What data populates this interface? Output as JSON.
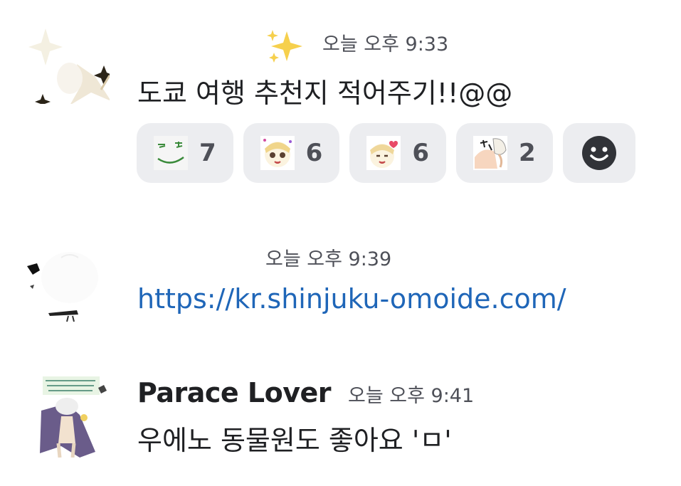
{
  "messages": [
    {
      "username": "",
      "timestamp": "오늘 오후 9:33",
      "content": "도쿄 여행 추천지 적어주기!!@@",
      "reactions": [
        {
          "emoji": "smirk-face-emoji",
          "count": "7"
        },
        {
          "emoji": "crying-girl-emoji",
          "count": "6"
        },
        {
          "emoji": "heart-girl-emoji",
          "count": "6"
        },
        {
          "emoji": "comic-pinch-emoji",
          "count": "2"
        }
      ]
    },
    {
      "username": "",
      "timestamp": "오늘 오후 9:39",
      "content": "https://kr.shinjuku-omoide.com/"
    },
    {
      "username": "Parace Lover",
      "timestamp": "오늘 오후 9:41",
      "content": "우에노 동물원도 좋아요 'ㅁ'"
    }
  ],
  "colors": {
    "background": "#ffffff",
    "reaction_bg": "#ecedf0",
    "link": "#1f66b8",
    "timestamp": "#4e5058",
    "text": "#1f2023"
  }
}
